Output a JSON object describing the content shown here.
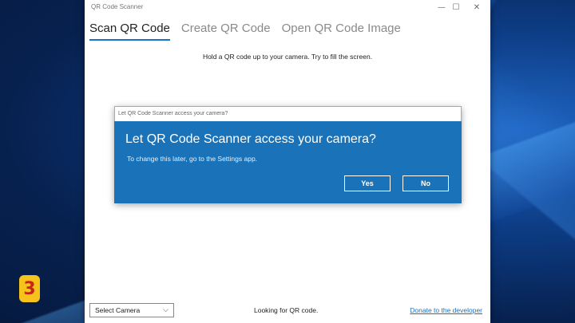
{
  "app_title": "QR Code Scanner",
  "window_controls": {
    "minimize": "—",
    "maximize": "☐",
    "close": "✕"
  },
  "tabs": [
    {
      "label": "Scan QR Code",
      "active": true
    },
    {
      "label": "Create QR Code",
      "active": false
    },
    {
      "label": "Open QR Code Image",
      "active": false
    }
  ],
  "instruction": "Hold a QR code up to your camera. Try to fill the screen.",
  "dialog": {
    "title": "Let QR Code Scanner access your camera?",
    "heading": "Let QR Code Scanner access your camera?",
    "subtext": "To change this later, go to the Settings app.",
    "yes_label": "Yes",
    "no_label": "No"
  },
  "footer": {
    "camera_select": "Select Camera",
    "chevron_icon": "chevron-down-icon",
    "status": "Looking for QR code.",
    "donate_link": "Donate to the developer"
  },
  "badge": {
    "number": "3"
  },
  "colors": {
    "accent": "#1a73b8",
    "link": "#1a6fc4",
    "badge": "#f6c21c"
  }
}
